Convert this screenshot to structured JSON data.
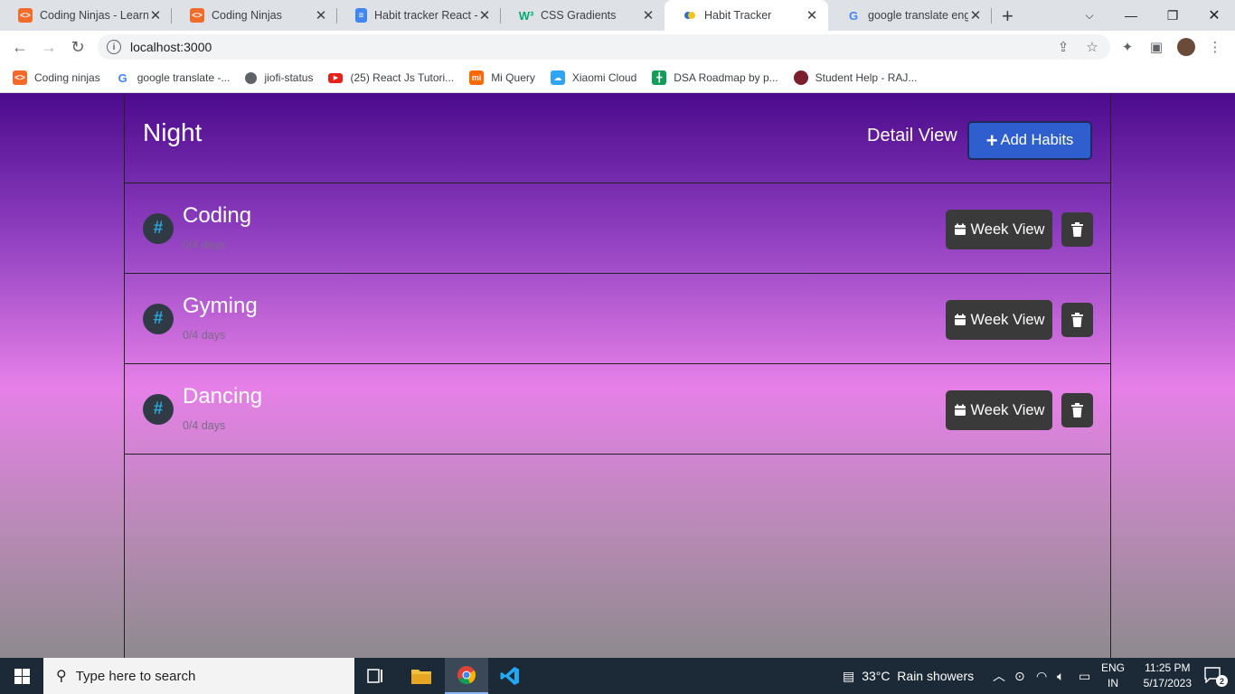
{
  "browser": {
    "tabs": [
      {
        "title": "Coding Ninjas - Learn",
        "icon": "coding-ninjas-icon"
      },
      {
        "title": "Coding Ninjas",
        "icon": "coding-ninjas-icon"
      },
      {
        "title": "Habit tracker React - G",
        "icon": "google-docs-icon"
      },
      {
        "title": "CSS Gradients",
        "icon": "w3schools-icon"
      },
      {
        "title": "Habit Tracker",
        "icon": "react-app-icon"
      },
      {
        "title": "google translate engl",
        "icon": "google-icon"
      }
    ],
    "active_tab": 4,
    "url": "localhost:3000",
    "bookmarks": [
      {
        "label": "Coding ninjas",
        "icon": "coding-ninjas-icon"
      },
      {
        "label": "google translate -...",
        "icon": "google-icon"
      },
      {
        "label": "jiofi-status",
        "icon": "globe-icon"
      },
      {
        "label": "(25) React Js Tutori...",
        "icon": "youtube-icon"
      },
      {
        "label": "Mi Query",
        "icon": "mi-icon"
      },
      {
        "label": "Xiaomi Cloud",
        "icon": "cloud-icon"
      },
      {
        "label": "DSA Roadmap by p...",
        "icon": "sheets-icon"
      },
      {
        "label": "Student Help - RAJ...",
        "icon": "university-icon"
      }
    ]
  },
  "app": {
    "title": "Night",
    "detail_view_label": "Detail View",
    "add_button_label": "Add Habits",
    "week_view_label": "Week View",
    "habits": [
      {
        "name": "Coding",
        "progress": "0/4 days"
      },
      {
        "name": "Gyming",
        "progress": "0/4 days"
      },
      {
        "name": "Dancing",
        "progress": "0/4 days"
      }
    ]
  },
  "taskbar": {
    "search_placeholder": "Type here to search",
    "weather": "33°C  Rain showers",
    "lang_top": "ENG",
    "lang_bottom": "IN",
    "time": "11:25 PM",
    "date": "5/17/2023",
    "notification_count": "2"
  }
}
